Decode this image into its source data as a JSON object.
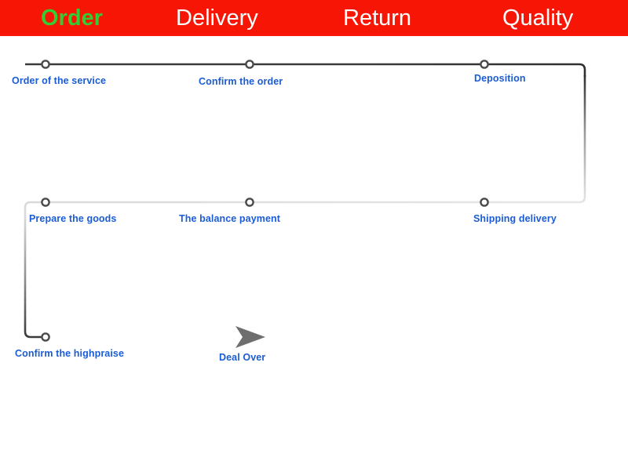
{
  "topbar": {
    "background_color": "#f71606",
    "active_color": "#33cc33",
    "inactive_color": "#ffffff",
    "tabs": [
      {
        "label": "Order",
        "active": true
      },
      {
        "label": "Delivery",
        "active": false
      },
      {
        "label": "Return",
        "active": false
      },
      {
        "label": "Quality",
        "active": false
      }
    ]
  },
  "flow": {
    "label_color": "#1a5cd6",
    "line_color_dark": "#3a3a3a",
    "line_color_light": "#e2e2e2",
    "node_fill": "#ffffff",
    "node_stroke": "#4a4a4a",
    "arrow_color": "#777777",
    "steps": [
      {
        "id": "order-of-the-service",
        "label": "Order of the service",
        "row": 1
      },
      {
        "id": "confirm-the-order",
        "label": "Confirm the order",
        "row": 1
      },
      {
        "id": "deposition",
        "label": "Deposition",
        "row": 1
      },
      {
        "id": "shipping-delivery",
        "label": "Shipping delivery",
        "row": 2
      },
      {
        "id": "the-balance-payment",
        "label": "The balance payment",
        "row": 2
      },
      {
        "id": "prepare-the-goods",
        "label": "Prepare the goods",
        "row": 2
      },
      {
        "id": "confirm-the-highpraise",
        "label": "Confirm the highpraise",
        "row": 3
      },
      {
        "id": "deal-over",
        "label": "Deal Over",
        "row": 3
      }
    ]
  }
}
